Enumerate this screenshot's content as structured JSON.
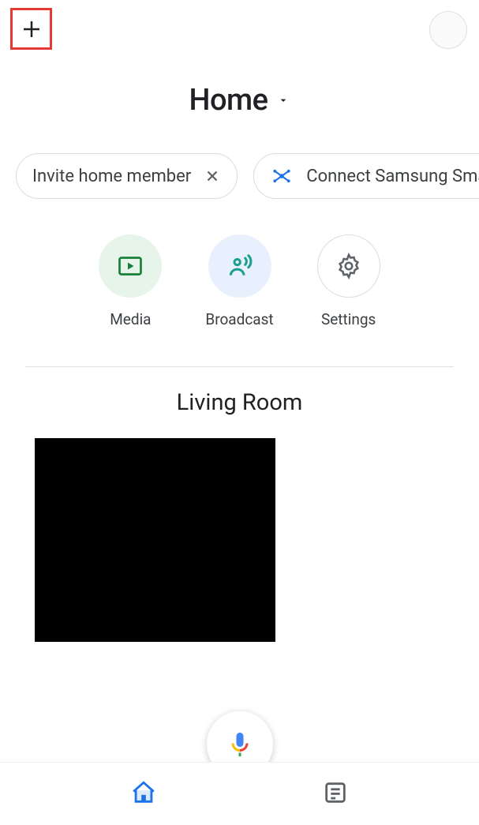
{
  "header": {
    "title": "Home"
  },
  "chips": [
    {
      "label": "Invite home member"
    },
    {
      "label": "Connect Samsung Sma"
    }
  ],
  "quick_actions": {
    "media": "Media",
    "broadcast": "Broadcast",
    "settings": "Settings"
  },
  "rooms": [
    {
      "name": "Living Room"
    }
  ]
}
